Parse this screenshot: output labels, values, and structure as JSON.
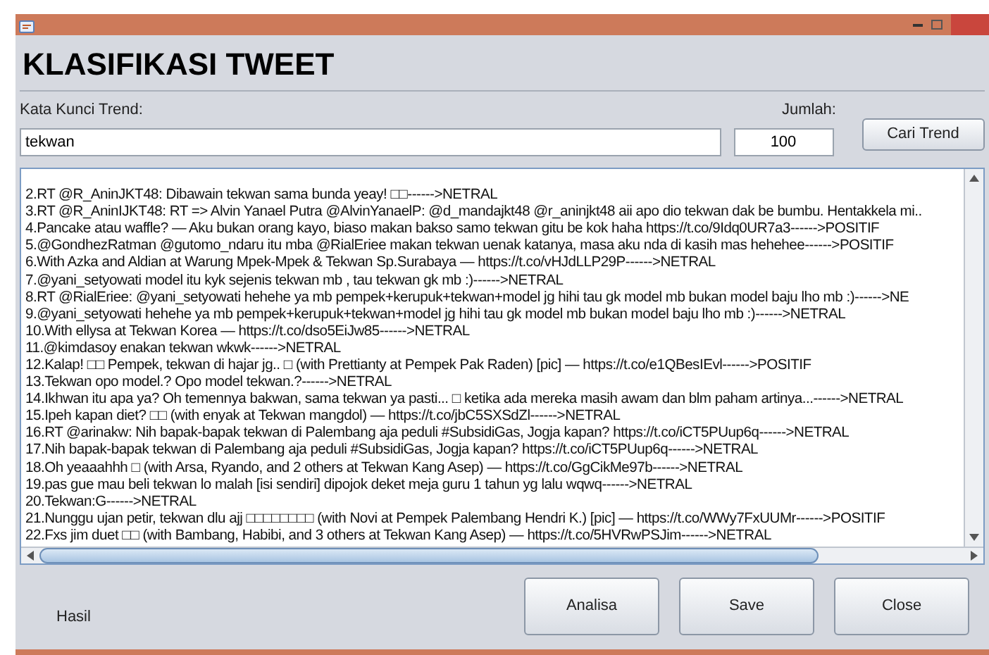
{
  "title": "KLASIFIKASI TWEET",
  "keyword": {
    "label": "Kata Kunci Trend:",
    "value": "tekwan"
  },
  "count": {
    "label": "Jumlah:",
    "value": "100"
  },
  "search_button": "Cari Trend",
  "results": [
    "2.RT @R_AninJKT48: Dibawain tekwan sama bunda yeay! □□------>NETRAL",
    "3.RT @R_AninIJKT48: RT => Alvin Yanael Putra @AlvinYanaelP: @d_mandajkt48 @r_aninjkt48 aii apo dio tekwan dak be bumbu. Hentakkela mi..",
    "4.Pancake atau waffle? — Aku bukan orang kayo, biaso makan bakso samo tekwan gitu be kok haha https://t.co/9Idq0UR7a3------>POSITIF",
    "5.@GondhezRatman  @gutomo_ndaru itu mba @RialEriee makan tekwan uenak katanya, masa aku nda di kasih mas hehehee------>POSITIF",
    "6.With Azka and Aldian at Warung Mpek-Mpek & Tekwan Sp.Surabaya — https://t.co/vHJdLLP29P------>NETRAL",
    "7.@yani_setyowati model itu kyk sejenis tekwan mb , tau tekwan gk mb :)------>NETRAL",
    "8.RT @RialEriee: @yani_setyowati hehehe ya mb pempek+kerupuk+tekwan+model jg hihi tau gk model mb bukan model baju lho mb :)------>NE",
    "9.@yani_setyowati hehehe ya mb pempek+kerupuk+tekwan+model jg hihi tau gk model mb bukan model baju lho mb :)------>NETRAL",
    "10.With ellysa at Tekwan Korea — https://t.co/dso5EiJw85------>NETRAL",
    "11.@kimdasoy enakan tekwan wkwk------>NETRAL",
    "12.Kalap! □□ Pempek, tekwan di hajar jg.. □ (with Prettianty at Pempek Pak Raden) [pic] — https://t.co/e1QBesIEvl------>POSITIF",
    "13.Tekwan opo model.? Opo model tekwan.?------>NETRAL",
    "14.Ikhwan itu apa ya? Oh temennya bakwan, sama tekwan ya pasti... □ ketika ada mereka masih awam dan blm paham artinya...------>NETRAL",
    "15.Ipeh kapan diet? □□ (with enyak at Tekwan mangdol) — https://t.co/jbC5SXSdZl------>NETRAL",
    "16.RT @arinakw: Nih bapak-bapak tekwan di Palembang aja peduli #SubsidiGas, Jogja kapan? https://t.co/iCT5PUup6q------>NETRAL",
    "17.Nih bapak-bapak tekwan di Palembang aja peduli #SubsidiGas, Jogja kapan? https://t.co/iCT5PUup6q------>NETRAL",
    "18.Oh yeaaahhh □ (with Arsa, Ryando, and 2 others at Tekwan Kang Asep) — https://t.co/GgCikMe97b------>NETRAL",
    "19.pas gue mau beli tekwan lo malah [isi sendiri] dipojok deket meja guru 1 tahun yg lalu wqwq------>NETRAL",
    "20.Tekwan:G------>NETRAL",
    "21.Nunggu ujan petir, tekwan dlu ajj □□□□□□□□ (with Novi at Pempek Palembang Hendri K.) [pic] — https://t.co/WWy7FxUUMr------>POSITIF",
    "22.Fxs jim duet □□ (with Bambang, Habibi, and 3 others at Tekwan Kang Asep) — https://t.co/5HVRwPSJim------>NETRAL"
  ],
  "status_label": "Hasil",
  "buttons": [
    "Analisa",
    "Save",
    "Close"
  ]
}
